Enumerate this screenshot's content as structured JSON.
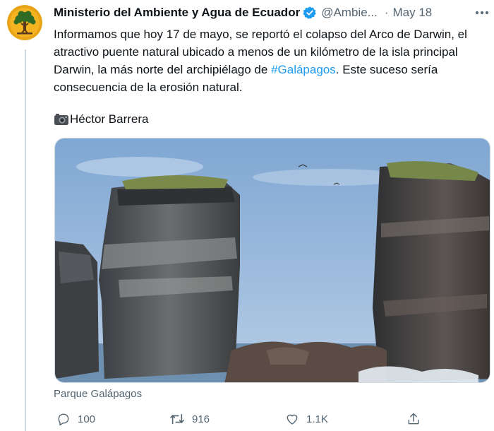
{
  "tweet": {
    "author_name": "Ministerio del Ambiente y Agua de Ecuador",
    "handle": "@Ambie...",
    "separator": "·",
    "date": "May 18",
    "text_before_hashtag": "Informamos que hoy 17 de mayo, se reportó el colapso del Arco de Darwin, el atractivo puente natural ubicado a menos de un kilómetro de la isla principal Darwin, la más norte del archipiélago de ",
    "hashtag": "#Galápagos",
    "text_after_hashtag": ". Este suceso sería consecuencia de la erosión natural.",
    "photo_credit": "Héctor Barrera",
    "location_label": "Parque Galápagos"
  },
  "actions": {
    "reply_count": "100",
    "retweet_count": "916",
    "like_count": "1.1K"
  },
  "icons": {
    "avatar": "tree-logo",
    "verified": "verified-badge-icon",
    "camera": "camera-icon",
    "reply": "reply-icon",
    "retweet": "retweet-icon",
    "like": "heart-icon",
    "share": "share-icon",
    "more": "more-options-icon"
  },
  "colors": {
    "accent": "#1d9bf0",
    "secondary_text": "#536471",
    "primary_text": "#0f1419",
    "avatar_bg": "#e8a317"
  }
}
